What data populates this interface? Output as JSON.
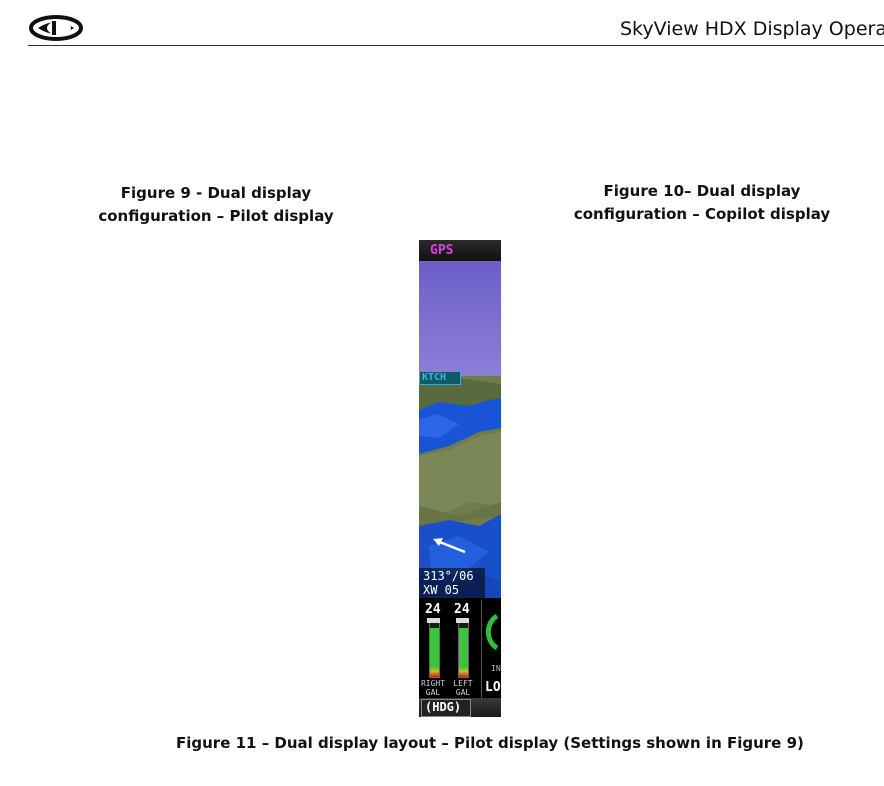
{
  "header": {
    "title": "SkyView HDX Display Opera"
  },
  "captions": {
    "figure9_line1": "Figure 9 - Dual display",
    "figure9_line2": "configuration – Pilot display",
    "figure10_line1": "Figure 10– Dual display",
    "figure10_line2": "configuration – Copilot display",
    "figure11": "Figure 11 – Dual display layout – Pilot display (Settings shown in Figure 9)"
  },
  "display": {
    "source_label": "GPS",
    "airport_label": "KTCH",
    "wind": {
      "line1": "313°/06",
      "line2": "XW  05"
    },
    "fuel": {
      "right": {
        "value": "24",
        "label_line1": "RIGHT",
        "label_line2": "GAL",
        "level": 0.9
      },
      "left": {
        "value": "24",
        "label_line1": "LEFT",
        "label_line2": "GAL",
        "level": 0.9
      }
    },
    "gauge_sublabel": "IN",
    "lower_label": "LO",
    "hdg_button": "(HDG)",
    "colors": {
      "gps_magenta": "#e040e0",
      "sky": "#7a6ccf",
      "terrain": "#6f7d4e",
      "water": "#1a54d6",
      "fuel_green": "#3cc43c"
    },
    "icons": {
      "logo": "dynon-logo",
      "wind_arrow": "wind-arrow-icon",
      "gauge": "engine-gauge-arc"
    }
  }
}
